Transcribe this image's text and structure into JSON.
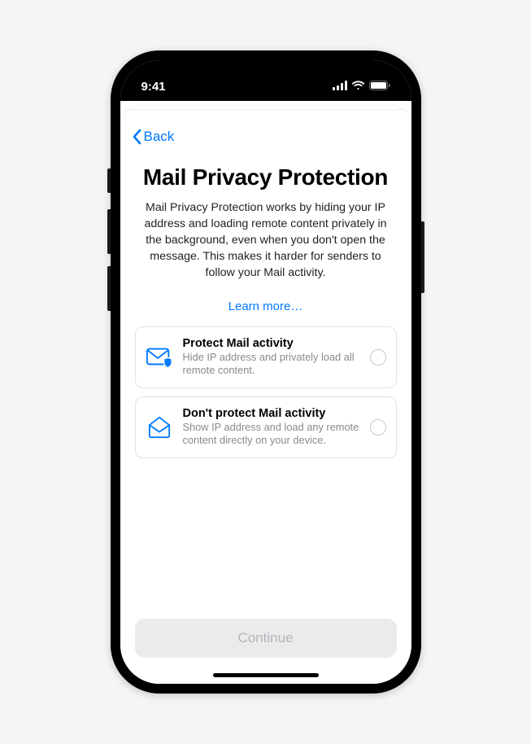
{
  "status": {
    "time": "9:41"
  },
  "nav": {
    "back_label": "Back"
  },
  "page": {
    "title": "Mail Privacy Protection",
    "description": "Mail Privacy Protection works by hiding your IP address and loading remote content privately in the background, even when you don't open the message. This makes it harder for senders to follow your Mail activity.",
    "learn_more_label": "Learn more…"
  },
  "options": [
    {
      "title": "Protect Mail activity",
      "description": "Hide IP address and privately load all remote content."
    },
    {
      "title": "Don't protect Mail activity",
      "description": "Show IP address and load any remote content directly on your device."
    }
  ],
  "footer": {
    "continue_label": "Continue"
  }
}
